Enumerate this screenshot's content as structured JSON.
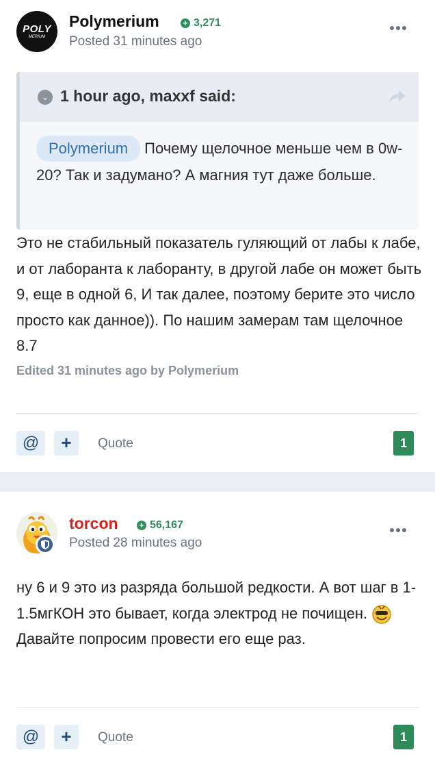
{
  "colors": {
    "page_bg": "#ebeef2",
    "reputation": "#2f8f5b",
    "torcon_name": "#d4231f",
    "reaction_badge": "#2f8a5a",
    "mention_bg": "#dde9f7",
    "mention_text": "#2f6fb0"
  },
  "posts": [
    {
      "author": "Polymerium",
      "avatar_text_1": "POLY",
      "avatar_text_2": "MERIUM",
      "reputation": "3,271",
      "posted": "Posted 31 minutes ago",
      "quote": {
        "citation": "1 hour ago, maxxf said:",
        "mention": "Polymerium",
        "text": "Почему щелочное меньше чем в 0w-20? Так и задумано? А магния тут даже больше."
      },
      "body": "Это не стабильный показатель гуляющий от лабы к лабе, и от лаборанта к лаборанту, в другой лабе он может быть 9, еще в одной 6, И так далее, поэтому берите это число просто как данное)). По нашим замерам там щелочное 8.7",
      "edited": "Edited 31 minutes ago by Polymerium",
      "actions": {
        "mention": "@",
        "multiquote": "+",
        "quote": "Quote",
        "reactions": "1"
      }
    },
    {
      "author": "torcon",
      "reputation": "56,167",
      "posted": "Posted 28 minutes ago",
      "body_line1": "ну 6 и 9 это из разряда большой редкости. А вот шаг в 1-1.5мгКОН это бывает, когда электрод не почищен.",
      "body_line2": "Давайте попросим провести его еще раз.",
      "actions": {
        "mention": "@",
        "multiquote": "+",
        "quote": "Quote",
        "reactions": "1"
      }
    }
  ]
}
